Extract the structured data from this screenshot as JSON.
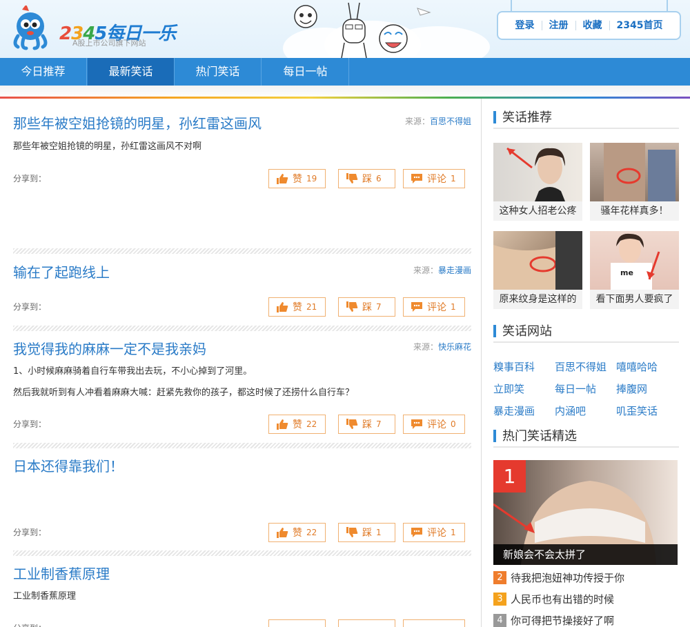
{
  "header": {
    "logo_text": "2345每日一乐",
    "logo_sub": "A股上市公司旗下网站",
    "links": [
      "登录",
      "注册",
      "收藏",
      "2345首页"
    ]
  },
  "nav": {
    "items": [
      "今日推荐",
      "最新笑话",
      "热门笑话",
      "每日一帖"
    ],
    "active_index": 1
  },
  "posts": [
    {
      "title": "那些年被空姐抢镜的明星，孙红雷这画风",
      "source_label": "来源：",
      "source": "百思不得姐",
      "body": [
        "那些年被空姐抢镜的明星，孙红雷这画风不对啊"
      ],
      "share": "分享到：",
      "like_label": "赞",
      "like_count": "19",
      "dislike_label": "踩",
      "dislike_count": "6",
      "comment_label": "评论",
      "comment_count": "1"
    },
    {
      "title": "输在了起跑线上",
      "source_label": "来源：",
      "source": "暴走漫画",
      "body": [],
      "share": "分享到：",
      "like_label": "赞",
      "like_count": "21",
      "dislike_label": "踩",
      "dislike_count": "7",
      "comment_label": "评论",
      "comment_count": "1"
    },
    {
      "title": "我觉得我的麻麻一定不是我亲妈",
      "source_label": "来源：",
      "source": "快乐麻花",
      "body": [
        "1、小时候麻麻骑着自行车带我出去玩，不小心掉到了河里。",
        "然后我就听到有人冲看着麻麻大喊：赶紧先救你的孩子，都这时候了还捞什么自行车？"
      ],
      "share": "分享到：",
      "like_label": "赞",
      "like_count": "22",
      "dislike_label": "踩",
      "dislike_count": "7",
      "comment_label": "评论",
      "comment_count": "0"
    },
    {
      "title": "日本还得靠我们！",
      "source_label": "",
      "source": "",
      "body": [],
      "share": "分享到：",
      "like_label": "赞",
      "like_count": "22",
      "dislike_label": "踩",
      "dislike_count": "1",
      "comment_label": "评论",
      "comment_count": "1"
    },
    {
      "title": "工业制香蕉原理",
      "source_label": "",
      "source": "",
      "body": [
        "工业制香蕉原理"
      ],
      "share": "分享到：",
      "like_label": "",
      "like_count": "",
      "dislike_label": "",
      "dislike_count": "",
      "comment_label": "",
      "comment_count": ""
    }
  ],
  "sidebar": {
    "recommend_title": "笑话推荐",
    "recommend": [
      {
        "caption": "这种女人招老公疼"
      },
      {
        "caption": "骚年花样真多！"
      },
      {
        "caption": "原来纹身是这样的"
      },
      {
        "caption": "看下面男人要疯了"
      }
    ],
    "sites_title": "笑话网站",
    "sites": [
      "糗事百科",
      "百思不得姐",
      "嘻嘻哈哈",
      "立即笑",
      "每日一帖",
      "捧腹网",
      "暴走漫画",
      "内涵吧",
      "叽歪笑话"
    ],
    "hot_title": "热门笑话精选",
    "hot_big": {
      "rank": "1",
      "caption": "新娘会不会太拼了"
    },
    "hot_list": [
      {
        "rank": "2",
        "text": "待我把泡妞神功传授于你",
        "color": "#ef7d2d"
      },
      {
        "rank": "3",
        "text": "人民币也有出错的时候",
        "color": "#f4a21d"
      },
      {
        "rank": "4",
        "text": "你可得把节操接好了啊",
        "color": "#999999"
      }
    ]
  }
}
